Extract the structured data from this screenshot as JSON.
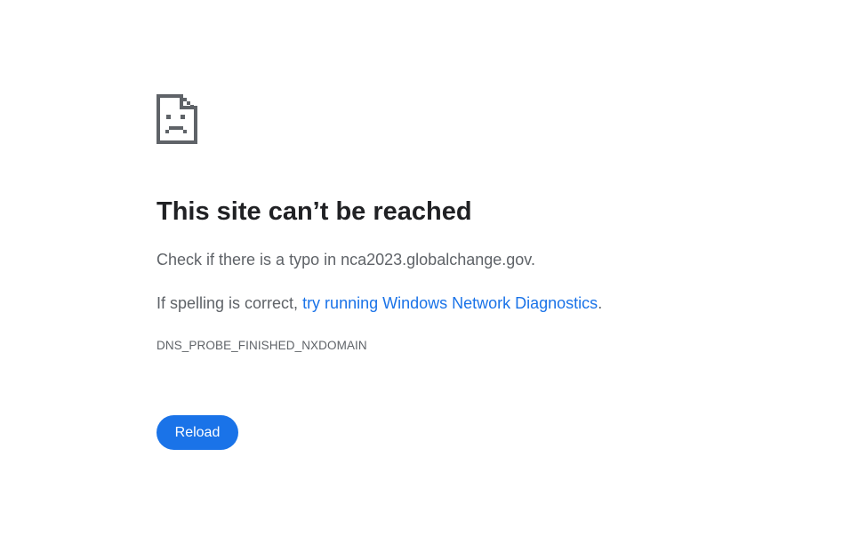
{
  "error": {
    "icon": "sad-document-icon",
    "heading": "This site can’t be reached",
    "typo_message": "Check if there is a typo in nca2023.globalchange.gov.",
    "spelling_prefix": "If spelling is correct, ",
    "diagnostics_link": "try running Windows Network Diagnostics",
    "spelling_suffix": ".",
    "error_code": "DNS_PROBE_FINISHED_NXDOMAIN",
    "reload_label": "Reload"
  },
  "colors": {
    "heading": "#202124",
    "body_text": "#5f6368",
    "link": "#1a73e8",
    "button_bg": "#1a73e8",
    "button_text": "#ffffff",
    "icon": "#5f6368"
  }
}
